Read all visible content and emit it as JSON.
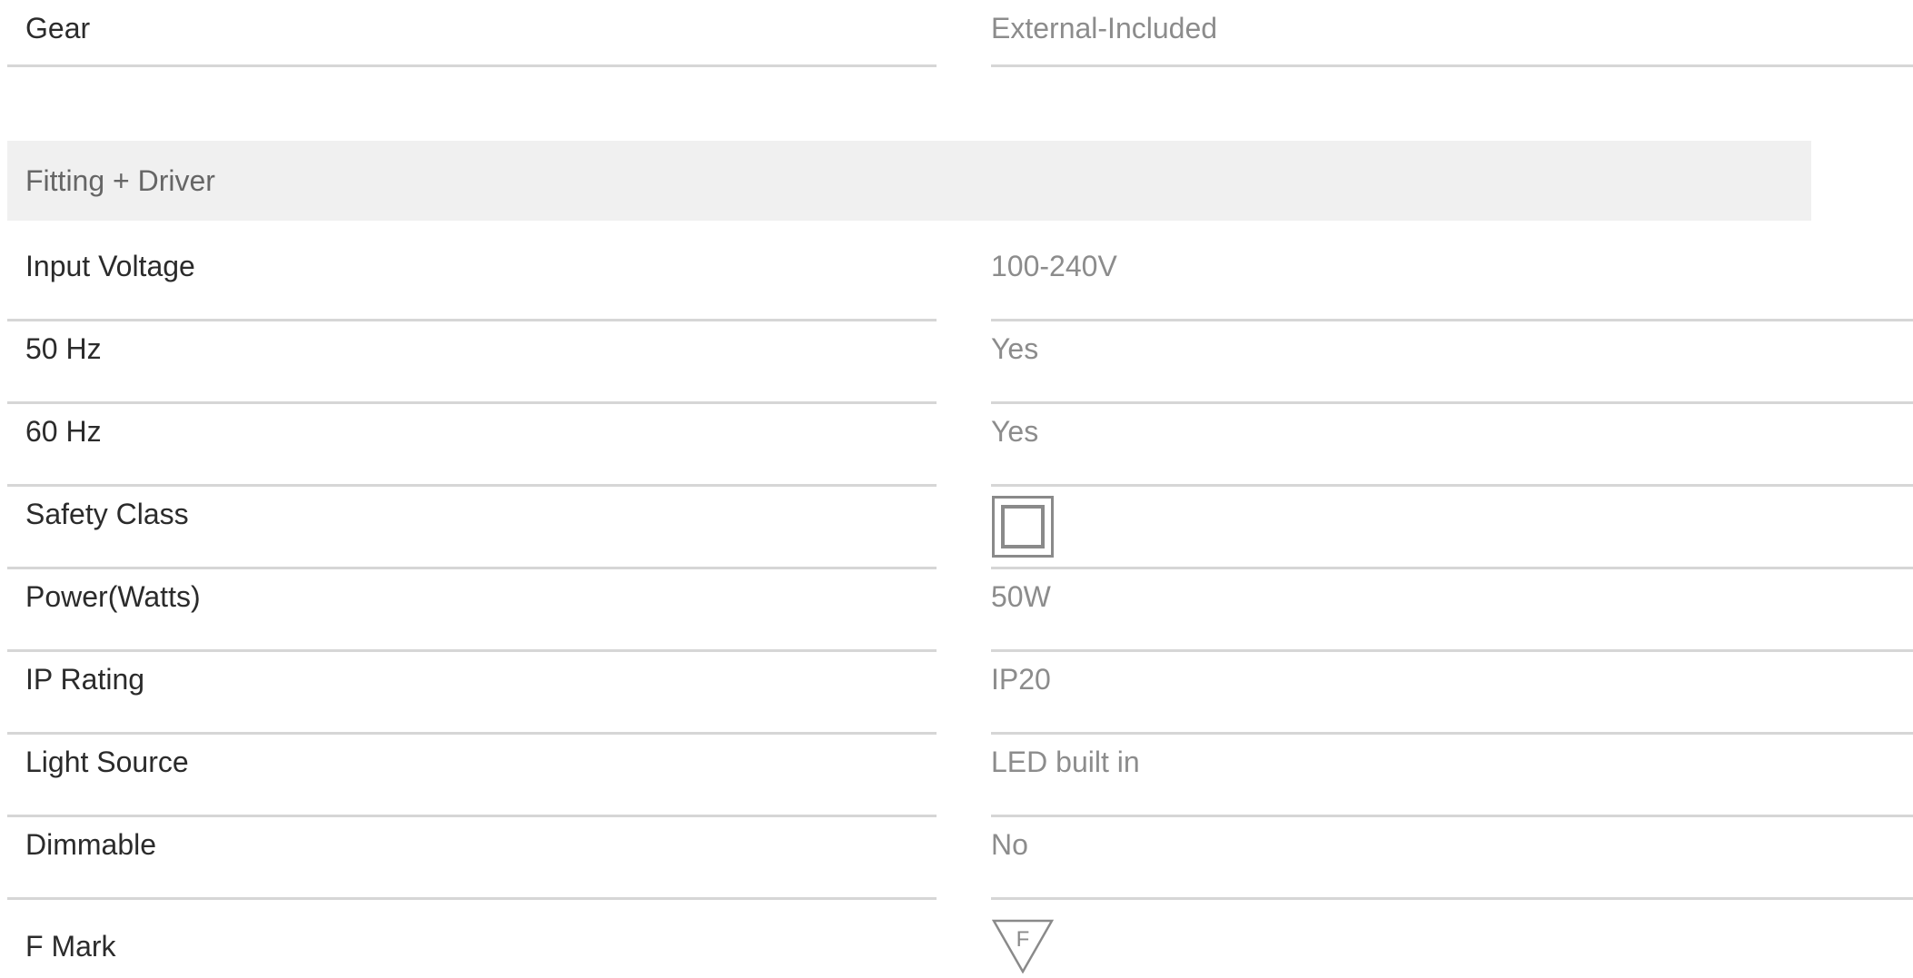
{
  "gear_row": {
    "label": "Gear",
    "value": "External-Included"
  },
  "section": {
    "title": "Fitting + Driver"
  },
  "specs": [
    {
      "label": "Input Voltage",
      "value": "100-240V"
    },
    {
      "label": "50 Hz",
      "value": "Yes"
    },
    {
      "label": "60 Hz",
      "value": "Yes"
    },
    {
      "label": "Safety Class",
      "value": "",
      "icon": "double-square-icon"
    },
    {
      "label": "Power(Watts)",
      "value": "50W"
    },
    {
      "label": "IP Rating",
      "value": "IP20"
    },
    {
      "label": "Light Source",
      "value": "LED built in"
    },
    {
      "label": "Dimmable",
      "value": "No"
    },
    {
      "label": "F Mark",
      "value": "",
      "icon": "f-mark-triangle-icon",
      "icon_text": "F"
    }
  ],
  "colors": {
    "label_text": "#2b2b2b",
    "value_text": "#8c8c8c",
    "divider": "#d6d6d6",
    "section_bg": "#f0f0f0",
    "icon_stroke": "#8a8a8a"
  }
}
